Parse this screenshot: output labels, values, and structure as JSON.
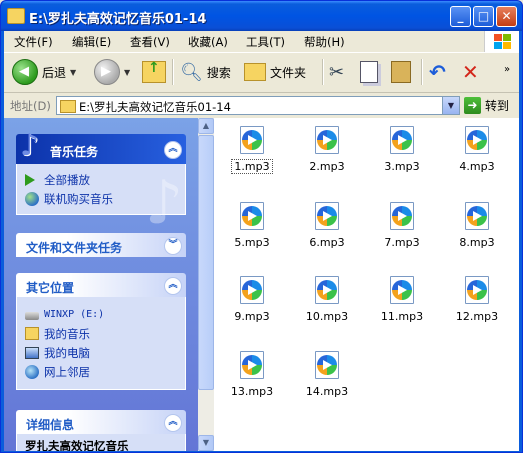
{
  "window": {
    "title": "E:\\罗扎夫高效记忆音乐01-14",
    "minimize": "_",
    "maximize": "□",
    "close": "✕"
  },
  "menu": [
    "文件(F)",
    "编辑(E)",
    "查看(V)",
    "收藏(A)",
    "工具(T)",
    "帮助(H)"
  ],
  "toolbar": {
    "back": "后退",
    "search": "搜索",
    "folders": "文件夹"
  },
  "address": {
    "label": "地址(D)",
    "value": "E:\\罗扎夫高效记忆音乐01-14",
    "go": "转到"
  },
  "left_pane": {
    "music_tasks": {
      "title": "音乐任务",
      "items": [
        "全部播放",
        "联机购买音乐"
      ]
    },
    "file_tasks": {
      "title": "文件和文件夹任务"
    },
    "other_places": {
      "title": "其它位置",
      "items": [
        "WINXP (E:)",
        "我的音乐",
        "我的电脑",
        "网上邻居"
      ]
    },
    "details": {
      "title": "详细信息",
      "text": "罗扎夫高效记忆音乐"
    }
  },
  "files": [
    "1.mp3",
    "2.mp3",
    "3.mp3",
    "4.mp3",
    "5.mp3",
    "6.mp3",
    "7.mp3",
    "8.mp3",
    "9.mp3",
    "10.mp3",
    "11.mp3",
    "12.mp3",
    "13.mp3",
    "14.mp3"
  ],
  "colors": {
    "titlebar": "#0054E3",
    "left_pane": "#6F8BDE",
    "link": "#0C32A9"
  }
}
